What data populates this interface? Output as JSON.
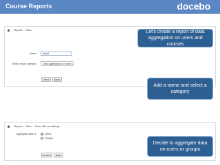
{
  "header": {
    "title": "Course Reports",
    "logo": "docebo"
  },
  "section1": {
    "breadcrumb": [
      "Report",
      "New"
    ],
    "name_label": "Name",
    "name_value": "report",
    "category_label": "Select report category",
    "category_value": "Data aggregation on users and",
    "next_label": "Next",
    "undo_label": "Undo"
  },
  "callout1": {
    "text": "Let's create a report of data aggregation on users and courses"
  },
  "callout2": {
    "text": "Add a name and select a category"
  },
  "section2": {
    "breadcrumb": [
      "Report",
      "New",
      "Rosa filter's settings"
    ],
    "aggregate_label": "Aggregate data on",
    "options": [
      "Users",
      "Groups"
    ],
    "selected_option": "Users",
    "confirm_label": "Confirm",
    "undo_label": "Undo"
  },
  "callout3": {
    "text": "Decide to aggregate data on users or groups"
  },
  "colors": {
    "header_bg": "#5b87c5",
    "callout_bg": "#2e5f92"
  }
}
